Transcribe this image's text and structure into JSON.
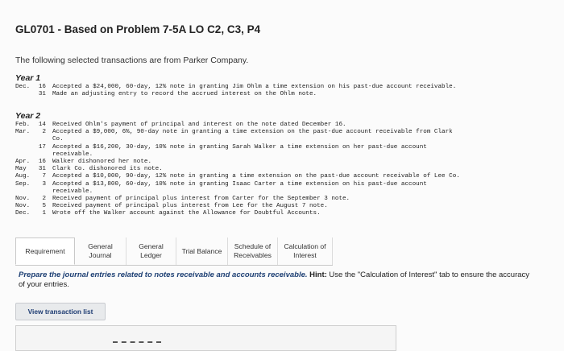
{
  "title": "GL0701 - Based on Problem 7-5A LO C2, C3, P4",
  "intro": "The following selected transactions are from Parker Company.",
  "year1": {
    "label": "Year 1",
    "rows": [
      {
        "month": "Dec.",
        "day": "16",
        "text": "Accepted a $24,000, 60-day, 12% note in granting Jim Ohlm a time extension on his past-due account receivable."
      },
      {
        "month": "",
        "day": "31",
        "text": "Made an adjusting entry to record the accrued interest on the Ohlm note."
      }
    ]
  },
  "year2": {
    "label": "Year 2",
    "rows": [
      {
        "month": "Feb.",
        "day": "14",
        "text": "Received Ohlm's payment of principal and interest on the note dated December 16."
      },
      {
        "month": "Mar.",
        "day": "2",
        "text": "Accepted a $9,000, 6%, 90-day note in granting a time extension on the past-due account receivable from Clark"
      },
      {
        "month": "",
        "day": "",
        "text": "Co."
      },
      {
        "month": "",
        "day": "17",
        "text": "Accepted a $16,200, 30-day, 10% note in granting Sarah Walker a time extension on her past-due account"
      },
      {
        "month": "",
        "day": "",
        "text": "receivable."
      },
      {
        "month": "Apr.",
        "day": "16",
        "text": "Walker dishonored her note."
      },
      {
        "month": "May",
        "day": "31",
        "text": "Clark Co. dishonored its note."
      },
      {
        "month": "Aug.",
        "day": "7",
        "text": "Accepted a $10,000, 90-day, 12% note in granting a time extension on the past-due account receivable of Lee Co."
      },
      {
        "month": "Sep.",
        "day": "3",
        "text": "Accepted a $13,800, 60-day, 10% note in granting Isaac Carter a time extension on his past-due account"
      },
      {
        "month": "",
        "day": "",
        "text": "receivable."
      },
      {
        "month": "Nov.",
        "day": "2",
        "text": "Received payment of principal plus interest from Carter for the September 3 note."
      },
      {
        "month": "Nov.",
        "day": "5",
        "text": "Received payment of principal plus interest from Lee for the August 7 note."
      },
      {
        "month": "Dec.",
        "day": "1",
        "text": "Wrote off the Walker account against the Allowance for Doubtful Accounts."
      }
    ]
  },
  "tabs": [
    {
      "label": "Requirement",
      "width": 74,
      "active": true
    },
    {
      "label": "General Journal",
      "width": 64
    },
    {
      "label": "General Ledger",
      "width": 62
    },
    {
      "label": "Trial Balance",
      "width": 64
    },
    {
      "label": "Schedule of Receivables",
      "width": 62
    },
    {
      "label": "Calculation of Interest",
      "width": 68
    }
  ],
  "instruction": {
    "lead": "Prepare the journal entries related to notes receivable and accounts receivable.",
    "hint_label": "Hint:",
    "hint_text": "Use the \"Calculation of Interest\" tab to ensure the accuracy of your entries."
  },
  "view_button": "View transaction list"
}
